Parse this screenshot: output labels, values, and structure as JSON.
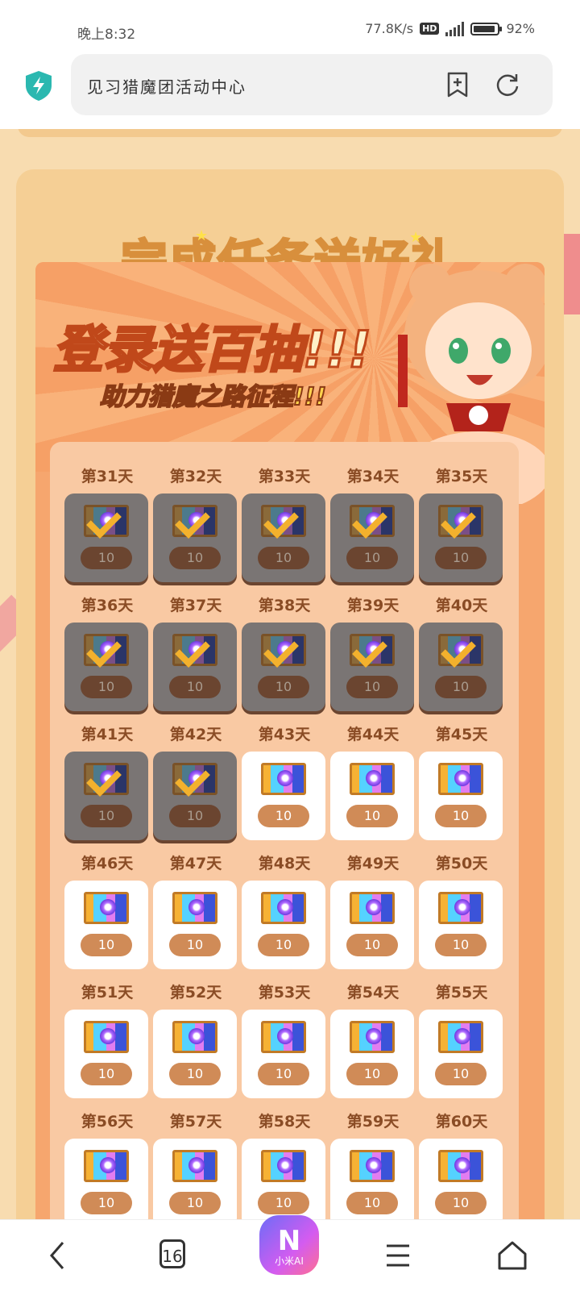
{
  "status": {
    "time": "晚上8:32",
    "speed": "77.8K/s",
    "hd": "HD",
    "battery": "92%"
  },
  "browser": {
    "url_title": "见习猎魔团活动中心",
    "tab_count": "16",
    "ai_label": "小米AI",
    "ai_logo": "N"
  },
  "panel": {
    "title": "完成任务送好礼"
  },
  "banner": {
    "title": "登录送百抽!!!",
    "subtitle": "助力猎魔之路征程!!!"
  },
  "days": [
    {
      "label": "第31天",
      "value": "10",
      "claimed": true
    },
    {
      "label": "第32天",
      "value": "10",
      "claimed": true
    },
    {
      "label": "第33天",
      "value": "10",
      "claimed": true
    },
    {
      "label": "第34天",
      "value": "10",
      "claimed": true
    },
    {
      "label": "第35天",
      "value": "10",
      "claimed": true
    },
    {
      "label": "第36天",
      "value": "10",
      "claimed": true
    },
    {
      "label": "第37天",
      "value": "10",
      "claimed": true
    },
    {
      "label": "第38天",
      "value": "10",
      "claimed": true
    },
    {
      "label": "第39天",
      "value": "10",
      "claimed": true
    },
    {
      "label": "第40天",
      "value": "10",
      "claimed": true
    },
    {
      "label": "第41天",
      "value": "10",
      "claimed": true
    },
    {
      "label": "第42天",
      "value": "10",
      "claimed": true
    },
    {
      "label": "第43天",
      "value": "10",
      "claimed": false
    },
    {
      "label": "第44天",
      "value": "10",
      "claimed": false
    },
    {
      "label": "第45天",
      "value": "10",
      "claimed": false
    },
    {
      "label": "第46天",
      "value": "10",
      "claimed": false
    },
    {
      "label": "第47天",
      "value": "10",
      "claimed": false
    },
    {
      "label": "第48天",
      "value": "10",
      "claimed": false
    },
    {
      "label": "第49天",
      "value": "10",
      "claimed": false
    },
    {
      "label": "第50天",
      "value": "10",
      "claimed": false
    },
    {
      "label": "第51天",
      "value": "10",
      "claimed": false
    },
    {
      "label": "第52天",
      "value": "10",
      "claimed": false
    },
    {
      "label": "第53天",
      "value": "10",
      "claimed": false
    },
    {
      "label": "第54天",
      "value": "10",
      "claimed": false
    },
    {
      "label": "第55天",
      "value": "10",
      "claimed": false
    },
    {
      "label": "第56天",
      "value": "10",
      "claimed": false
    },
    {
      "label": "第57天",
      "value": "10",
      "claimed": false
    },
    {
      "label": "第58天",
      "value": "10",
      "claimed": false
    },
    {
      "label": "第59天",
      "value": "10",
      "claimed": false
    },
    {
      "label": "第60天",
      "value": "10",
      "claimed": false
    }
  ],
  "colors": {
    "accent": "#d08b57",
    "panel": "#f5cf95",
    "claimed": "#7a7574"
  },
  "icons": [
    "shield-icon",
    "bookmark-add-icon",
    "refresh-icon",
    "back-icon",
    "menu-icon",
    "home-icon",
    "ticket-icon",
    "checkmark-icon"
  ]
}
